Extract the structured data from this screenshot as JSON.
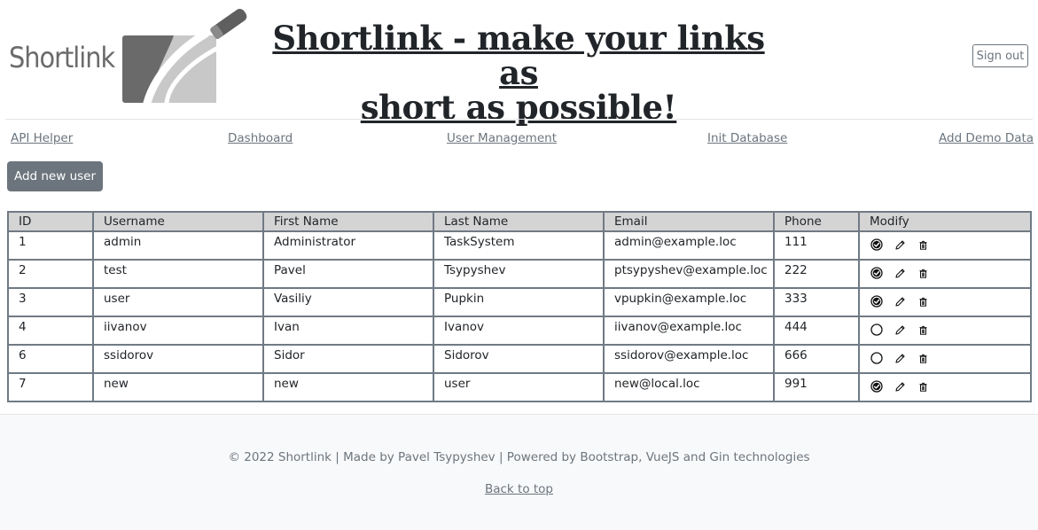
{
  "header": {
    "logo_text": "Shortlink",
    "title_line1": "Shortlink - make your links as",
    "title_line2": "short as possible!",
    "signout_label": "Sign out"
  },
  "nav": {
    "items": [
      {
        "label": "API Helper"
      },
      {
        "label": "Dashboard"
      },
      {
        "label": "User Management"
      },
      {
        "label": "Init Database"
      },
      {
        "label": "Add Demo Data"
      }
    ]
  },
  "actions": {
    "add_user_label": "Add new user"
  },
  "table": {
    "columns": [
      "ID",
      "Username",
      "First Name",
      "Last Name",
      "Email",
      "Phone",
      "Modify"
    ],
    "rows": [
      {
        "id": "1",
        "username": "admin",
        "first_name": "Administrator",
        "last_name": "TaskSystem",
        "email": "admin@example.loc",
        "phone": "111",
        "status_icon": "checked-circle-icon"
      },
      {
        "id": "2",
        "username": "test",
        "first_name": "Pavel",
        "last_name": "Tsypyshev",
        "email": "ptsypyshev@example.loc",
        "phone": "222",
        "status_icon": "checked-circle-icon"
      },
      {
        "id": "3",
        "username": "user",
        "first_name": "Vasiliy",
        "last_name": "Pupkin",
        "email": "vpupkin@example.loc",
        "phone": "333",
        "status_icon": "checked-circle-icon"
      },
      {
        "id": "4",
        "username": "iivanov",
        "first_name": "Ivan",
        "last_name": "Ivanov",
        "email": "iivanov@example.loc",
        "phone": "444",
        "status_icon": "empty-circle-icon"
      },
      {
        "id": "6",
        "username": "ssidorov",
        "first_name": "Sidor",
        "last_name": "Sidorov",
        "email": "ssidorov@example.loc",
        "phone": "666",
        "status_icon": "empty-circle-icon"
      },
      {
        "id": "7",
        "username": "new",
        "first_name": "new",
        "last_name": "user",
        "email": "new@local.loc",
        "phone": "991",
        "status_icon": "checked-circle-icon"
      }
    ]
  },
  "footer": {
    "copyright": "© 2022 Shortlink | Made by Pavel Tsypyshev | Powered by Bootstrap, VueJS and Gin technologies",
    "back_to_top": "Back to top"
  }
}
